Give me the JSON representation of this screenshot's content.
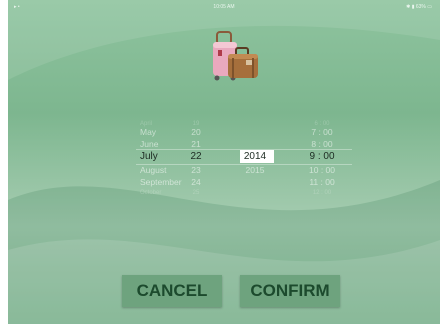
{
  "status_bar": {
    "left": "▸ •",
    "time": "10:05 AM",
    "right": "✱ ▮ 63% ▭"
  },
  "picker": {
    "months": [
      "April",
      "May",
      "June",
      "July",
      "August",
      "September",
      "October"
    ],
    "days": [
      "19",
      "20",
      "21",
      "22",
      "23",
      "24",
      "25"
    ],
    "years": [
      "2014",
      "2015"
    ],
    "times": [
      "6 : 00",
      "7 : 00",
      "8 : 00",
      "9 : 00",
      "10 : 00",
      "11 : 00",
      "12 : 00"
    ],
    "selected_index": 3
  },
  "buttons": {
    "cancel_label": "CANCEL",
    "confirm_label": "CONFIRM"
  },
  "colors": {
    "background": "#8fc49f",
    "button": "#6ea37e",
    "button_text": "#1c4a2d"
  },
  "icons": {
    "app_icon": "luggage-icon"
  }
}
